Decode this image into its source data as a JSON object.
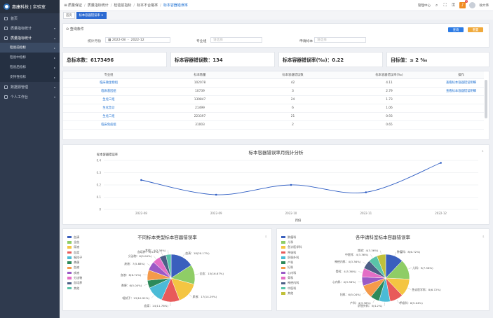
{
  "brand": "惠康科技 | 实验室",
  "sidebar": [
    {
      "label": "首页"
    },
    {
      "label": "质量指标统计"
    },
    {
      "label": "质量指标统计"
    },
    {
      "label": "检验前指标"
    },
    {
      "label": "检验中指标"
    },
    {
      "label": "检验后指标"
    },
    {
      "label": "支持性指标"
    },
    {
      "label": "数据源管理"
    },
    {
      "label": "个人工作台"
    }
  ],
  "breadcrumb": [
    "质量保证",
    "质量指标统计",
    "检验前指标",
    "标本不合格率",
    "标本容器错误率"
  ],
  "topbar": {
    "dept": "管理中心",
    "badge": "1",
    "user": "徐大伟"
  },
  "tags": [
    "首页",
    "标本容器错误率"
  ],
  "filter": {
    "title": "查询条件",
    "date_label": "统计月份",
    "date_from": "2022-08",
    "date_sep": "-",
    "date_to": "2022-12",
    "group_label": "专业组",
    "group_placeholder": "请选择",
    "type_label": "申请标本",
    "type_placeholder": "请选择",
    "search_btn": "查询",
    "reset_btn": "重置"
  },
  "stats": [
    "总标本数：6173496",
    "标本容器错误数：134",
    "标本容器错误率(‰)：0.22",
    "目标值：≤ 2 ‰"
  ],
  "table": {
    "headers": [
      "专业组",
      "标本数量",
      "标本容器错误数",
      "标本容器错误率(‰)",
      "操作"
    ],
    "rows": [
      [
        "临床微生物组",
        "102078",
        "42",
        "4.11",
        "查看标本容器错误明细"
      ],
      [
        "临床基因组",
        "10739",
        "3",
        "2.79",
        "查看标本容器错误明细"
      ],
      [
        "生化三组",
        "139847",
        "24",
        "1.73",
        ""
      ],
      [
        "生化急诊",
        "21499",
        "6",
        "1.06",
        ""
      ],
      [
        "生化二组",
        "223397",
        "21",
        "0.93",
        ""
      ],
      [
        "临床免疫组",
        "31003",
        "2",
        "0.65",
        ""
      ]
    ]
  },
  "line_chart": {
    "title": "标本容器错误率月统计分析",
    "chart_data": {
      "type": "line",
      "title": "标本容器错误率月统计分析",
      "ylabel": "标本容器错误率",
      "xlabel": "月份",
      "categories": [
        "2022-08",
        "2022-09",
        "2022-10",
        "2022-11",
        "2022-12"
      ],
      "values": [
        0.24,
        0.12,
        0.2,
        0.14,
        0.38
      ],
      "ylim": [
        0,
        0.4
      ],
      "yticks": [
        "0",
        "0.1",
        "0.2",
        "0.3",
        "0.4"
      ],
      "grid": true,
      "color": "#2e5dc3"
    }
  },
  "pie1": {
    "title": "不同标本类型标本容器错误率",
    "chart_data": {
      "type": "pie",
      "title": "不同标本类型标本容器错误率",
      "series": [
        {
          "name": "血清",
          "value": 18,
          "label": "血清：18(20.17%)"
        },
        {
          "name": "全血",
          "value": 15,
          "label": "全血：15(16.67%)"
        },
        {
          "name": "尿液",
          "value": 17,
          "label": "尿液：17(14.29%)"
        },
        {
          "name": "血浆",
          "value": 14,
          "label": "血浆：14(11.76%)"
        },
        {
          "name": "咽拭子",
          "value": 13,
          "label": "咽拭子：13(10.92%)"
        },
        {
          "name": "粪便",
          "value": 6,
          "label": "粪便：6(5.04%)"
        },
        {
          "name": "血液",
          "value": 8,
          "label": "血液：8(6.72%)"
        },
        {
          "name": "痰液",
          "value": 7,
          "label": "痰液：7(5.88%)"
        },
        {
          "name": "分泌物",
          "value": 6,
          "label": "分泌物：6(5.04%)"
        },
        {
          "name": "血培养",
          "value": 5,
          "label": "血培养：5(4.2%)"
        },
        {
          "name": "其他",
          "value": 4,
          "label": "其他：4(3.36%)"
        }
      ],
      "colors": [
        "#3a5fbd",
        "#8fcd66",
        "#f4c542",
        "#e85a5a",
        "#4bbbd6",
        "#2c8a5a",
        "#f49a4a",
        "#9a5ac6",
        "#e46ec6",
        "#4c5f86",
        "#59c4a8"
      ]
    }
  },
  "pie2": {
    "title": "各申请科室标本容器错误率",
    "chart_data": {
      "type": "pie",
      "title": "各申请科室标本容器错误率",
      "series": [
        {
          "name": "肿瘤科",
          "value": 8,
          "label": "肿瘤科：8(6.72%)"
        },
        {
          "name": "儿科",
          "value": 9,
          "label": "儿科：9(7.56%)"
        },
        {
          "name": "急诊医学科",
          "value": 8,
          "label": "急诊医学科：8(6.72%)"
        },
        {
          "name": "呼吸科",
          "value": 6,
          "label": "呼吸科：6(5.04%)"
        },
        {
          "name": "肝胆外科",
          "value": 5,
          "label": "肝胆外科：5(4.2%)"
        },
        {
          "name": "产科",
          "value": 4,
          "label": "产科：4(3.36%)"
        },
        {
          "name": "妇科",
          "value": 6,
          "label": "妇科：6(5.04%)"
        },
        {
          "name": "心内科",
          "value": 4,
          "label": "心内科：4(3.36%)"
        },
        {
          "name": "骨科",
          "value": 4,
          "label": "骨科：4(3.36%)"
        },
        {
          "name": "神经内科",
          "value": 4,
          "label": "神经内科：4(3.36%)"
        },
        {
          "name": "中医科",
          "value": 4,
          "label": "中医科：4(3.36%)"
        },
        {
          "name": "其他",
          "value": 4,
          "label": "其他：4(3.36%)"
        }
      ],
      "colors": [
        "#3a5fbd",
        "#8fcd66",
        "#f4c542",
        "#e85a5a",
        "#4bbbd6",
        "#2c8a5a",
        "#f49a4a",
        "#9a5ac6",
        "#e46ec6",
        "#4c5f86",
        "#59c4a8",
        "#c0c03a"
      ]
    }
  }
}
